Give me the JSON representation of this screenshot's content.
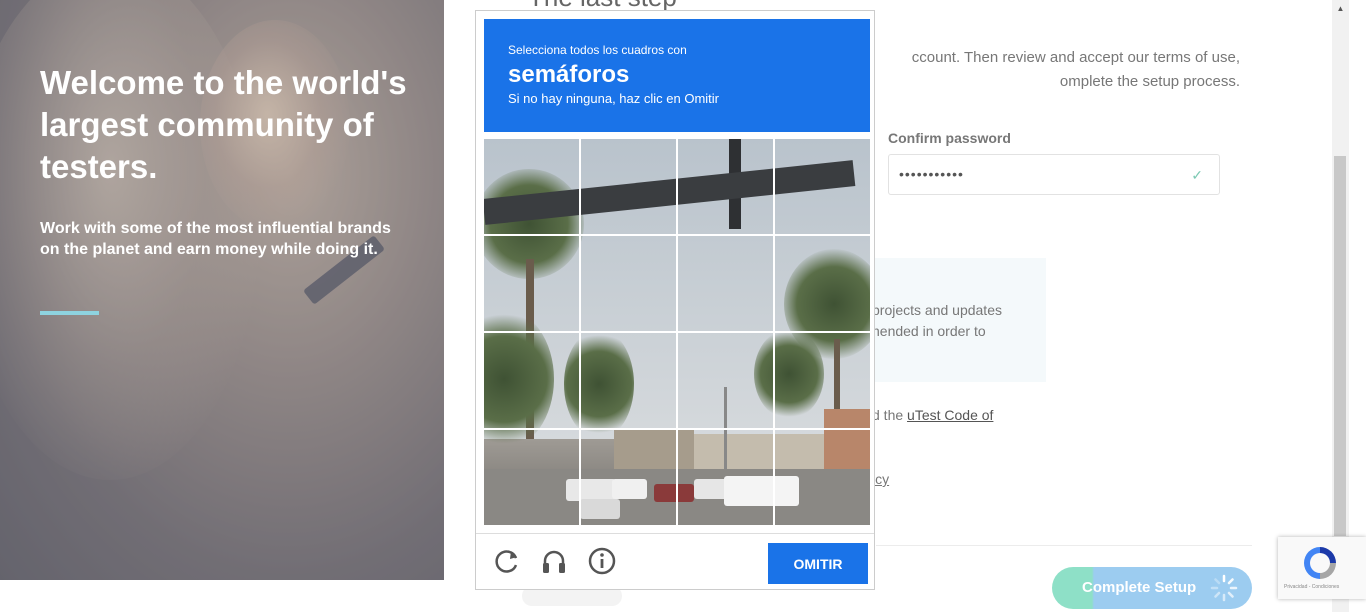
{
  "hero": {
    "title": "Welcome to the world's largest community of testers.",
    "subtitle": "Work with some of the most influential brands on the planet and earn money while doing it."
  },
  "form": {
    "step_title": "The last step",
    "intro_line1": "ccount. Then review and accept our terms of use,",
    "intro_line2": "omplete the setup process.",
    "confirm_label": "Confirm password",
    "confirm_value": "•••••••••••",
    "info_line1": "projects and updates",
    "info_line2": "nended in order to",
    "code_prefix": "d the ",
    "code_link": "uTest Code of",
    "policy_link": "icy",
    "complete_button": "Complete Setup"
  },
  "captcha": {
    "instruction": "Selecciona todos los cuadros con",
    "target": "semáforos",
    "hint": "Si no hay ninguna, haz clic en Omitir",
    "skip_button": "OMITIR",
    "icons": [
      "reload-icon",
      "audio-icon",
      "info-icon"
    ]
  },
  "badge": {
    "terms": "Privacidad - Condiciones"
  },
  "colors": {
    "captcha_blue": "#1a73e8",
    "accent_teal": "#8ee0c7",
    "accent_light_blue": "#9cccf0",
    "rule_color": "#8ed3e0"
  }
}
